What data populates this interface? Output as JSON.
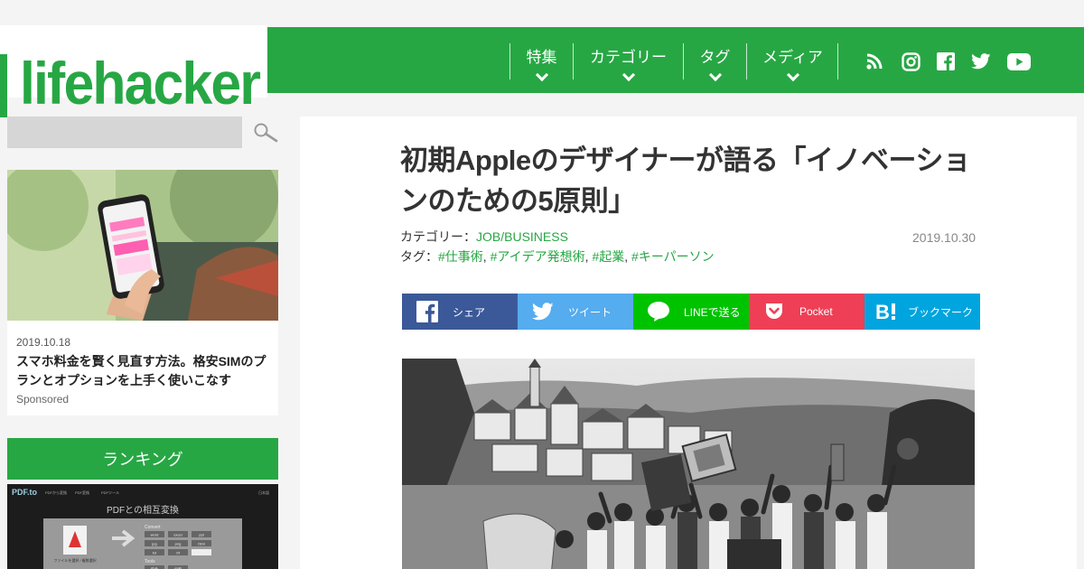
{
  "site": {
    "logo": "lifehacker"
  },
  "nav": {
    "items": [
      {
        "label": "特集"
      },
      {
        "label": "カテゴリー"
      },
      {
        "label": "タグ"
      },
      {
        "label": "メディア"
      }
    ],
    "social_icons": [
      "rss-icon",
      "instagram-icon",
      "facebook-icon",
      "twitter-icon",
      "youtube-icon"
    ]
  },
  "sidebar": {
    "search": {
      "placeholder": ""
    },
    "ad": {
      "date": "2019.10.18",
      "title": "スマホ料金を賢く見直す方法。格安SIMのプランとオプションを上手く使いこなす",
      "sponsor": "Sponsored"
    },
    "ranking": {
      "heading": "ランキング",
      "thumb": {
        "logo": "PDF.to",
        "menu": [
          "PDFから変換",
          "PDF変換",
          "PDFツール"
        ],
        "lang": "日本語",
        "heading": "PDFとの相互変換",
        "file_caption": "ファイルを選択 / 複数選択",
        "convert_label": "Convert",
        "tools_label": "Tools",
        "convert_buttons": [
          "word",
          "excel",
          "ppt",
          "jpg",
          "png",
          "html",
          "txt",
          "rtf"
        ],
        "tool_buttons": [
          "結合",
          "分割"
        ]
      }
    }
  },
  "article": {
    "title": "初期Appleのデザイナーが語る「イノベーションのための5原則」",
    "category_label": "カテゴリー：",
    "category": "JOB/BUSINESS",
    "tags_label": "タグ：",
    "tags": [
      "#仕事術",
      "#アイデア発想術",
      "#起業",
      "#キーパーソン"
    ],
    "date": "2019.10.30"
  },
  "share": [
    {
      "label": "シェア",
      "color": "#3b5998",
      "icon": "facebook-icon"
    },
    {
      "label": "ツイート",
      "color": "#55acee",
      "icon": "twitter-icon"
    },
    {
      "label": "LINEで送る",
      "color": "#00c300",
      "icon": "line-icon"
    },
    {
      "label": "Pocket",
      "color": "#ef3f56",
      "icon": "pocket-icon"
    },
    {
      "label": "ブックマーク",
      "color": "#00a4de",
      "icon": "hatena-bookmark-icon"
    }
  ],
  "colors": {
    "brand_green": "#27a744",
    "link_green": "#27a744"
  }
}
